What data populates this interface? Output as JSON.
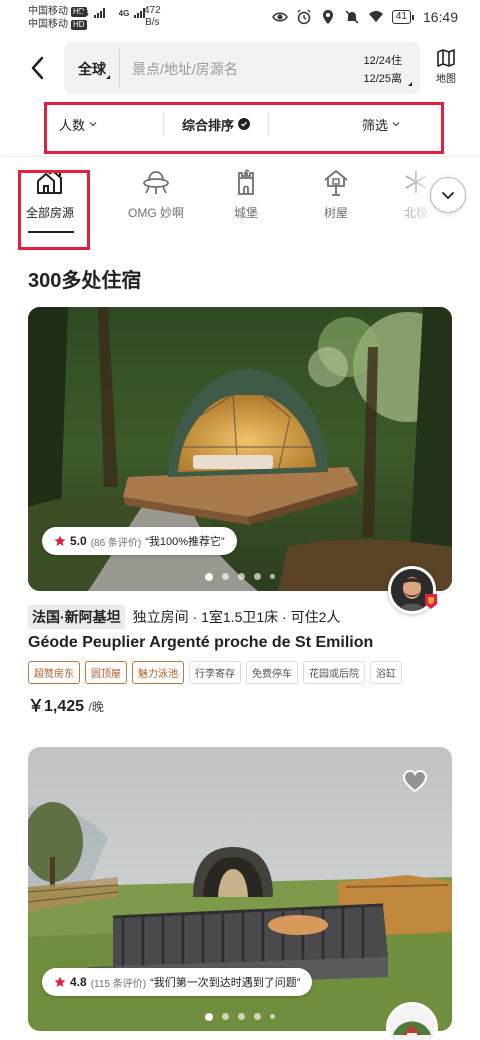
{
  "status_bar": {
    "carrier1": "中国移动",
    "carrier2": "中国移动",
    "hd": "HD",
    "net1": "4G",
    "net2": "4G",
    "speed_value": "472",
    "speed_unit": "B/s",
    "battery": "41",
    "time": "16:49"
  },
  "header": {
    "region": "全球",
    "search_placeholder": "景点/地址/房源名",
    "checkin": "12/24住",
    "checkout": "12/25离",
    "map_label": "地图"
  },
  "filters": {
    "guests": "人数",
    "sort": "综合排序",
    "filter": "筛选"
  },
  "categories": [
    {
      "label": "全部房源",
      "icon": "houses-icon",
      "active": true
    },
    {
      "label": "OMG 妙啊",
      "icon": "ufo-icon",
      "active": false
    },
    {
      "label": "城堡",
      "icon": "castle-icon",
      "active": false
    },
    {
      "label": "树屋",
      "icon": "treehouse-icon",
      "active": false
    },
    {
      "label": "北极",
      "icon": "snowflake-icon",
      "active": false
    }
  ],
  "results": {
    "count_label": "300多处住宿"
  },
  "listings": [
    {
      "rating": "5.0",
      "review_count": "(86 条评价)",
      "quote": "“我100%推荐它”",
      "location": "法国·新阿基坦",
      "details": "独立房间 · 1室1.5卫1床 · 可住2人",
      "title": "Géode Peuplier Argenté proche de St Emilion",
      "tags": [
        {
          "label": "超赞房东",
          "highlight": true
        },
        {
          "label": "圆顶屋",
          "highlight": true
        },
        {
          "label": "魅力泳池",
          "highlight": true
        },
        {
          "label": "行李寄存",
          "highlight": false
        },
        {
          "label": "免费停车",
          "highlight": false
        },
        {
          "label": "花园或后院",
          "highlight": false
        },
        {
          "label": "浴缸",
          "highlight": false
        }
      ],
      "price": "￥1,425",
      "price_unit": "/晚"
    },
    {
      "rating": "4.8",
      "review_count": "(115 条评价)",
      "quote": "“我们第一次到达时遇到了问题”"
    }
  ],
  "colors": {
    "highlight_red": "#e3203d",
    "tag_orange": "#b35d24",
    "star_red": "#e51d3f"
  }
}
